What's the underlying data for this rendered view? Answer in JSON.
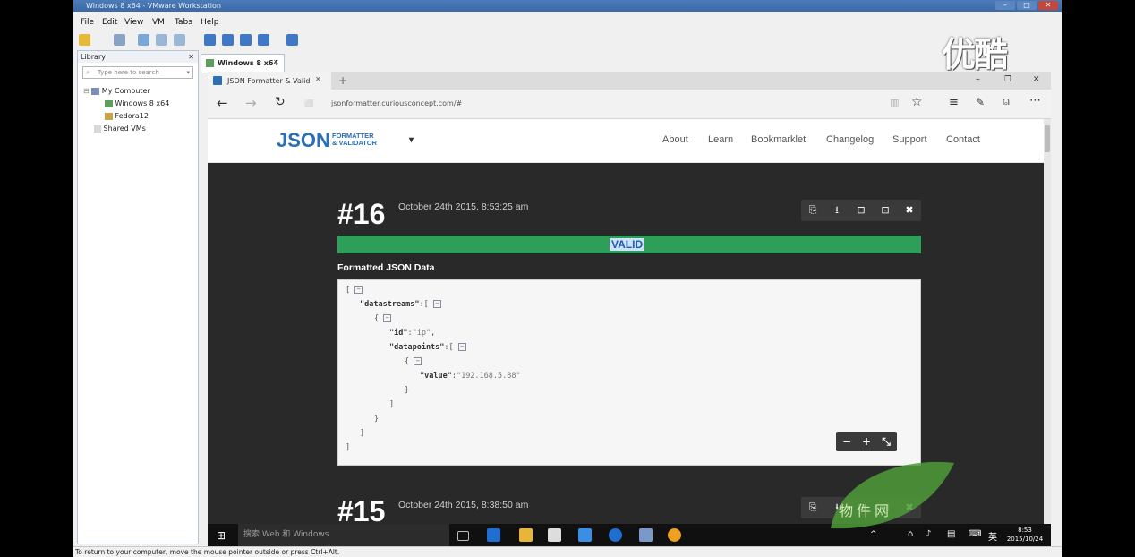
{
  "vmware": {
    "title": "Windows 8 x64 - VMware Workstation",
    "menu": [
      "File",
      "Edit",
      "View",
      "VM",
      "Tabs",
      "Help"
    ],
    "library": {
      "title": "Library",
      "search_placeholder": "Type here to search",
      "tree": [
        "My Computer",
        "Windows 8 x64",
        "Fedora12",
        "Shared VMs"
      ]
    },
    "tab": "Windows 8 x64",
    "status": "To return to your computer, move the mouse pointer outside or press Ctrl+Alt."
  },
  "browser": {
    "tab_title": "JSON Formatter & Valid",
    "url": "jsonformatter.curiousconcept.com/#"
  },
  "site": {
    "logo_main": "JSON",
    "logo_sub1": "FORMATTER",
    "logo_sub2": "& VALIDATOR",
    "nav": [
      "About",
      "Learn",
      "Bookmarklet",
      "Changelog",
      "Support",
      "Contact"
    ]
  },
  "entry16": {
    "number": "#16",
    "date": "October 24th 2015, 8:53:25 am",
    "status": "VALID",
    "formatted_label": "Formatted JSON Data",
    "json": {
      "open_bracket": "[",
      "k_datastreams": "\"datastreams\"",
      "k_id": "\"id\"",
      "v_id": "\"ip\"",
      "k_datapoints": "\"datapoints\"",
      "k_value": "\"value\"",
      "v_value": "\"192.168.5.88\""
    }
  },
  "entry15": {
    "number": "#15",
    "date": "October 24th 2015, 8:38:50 am"
  },
  "taskbar": {
    "search_placeholder": "搜索 Web 和 Windows",
    "time": "8:53",
    "date": "2015/10/24"
  },
  "watermark": {
    "brand": "优酷",
    "leaf_text": "物件网"
  },
  "colors": {
    "valid_green": "#2e9e5b",
    "logo_blue": "#2b6fb5",
    "site_dark": "#292929"
  }
}
